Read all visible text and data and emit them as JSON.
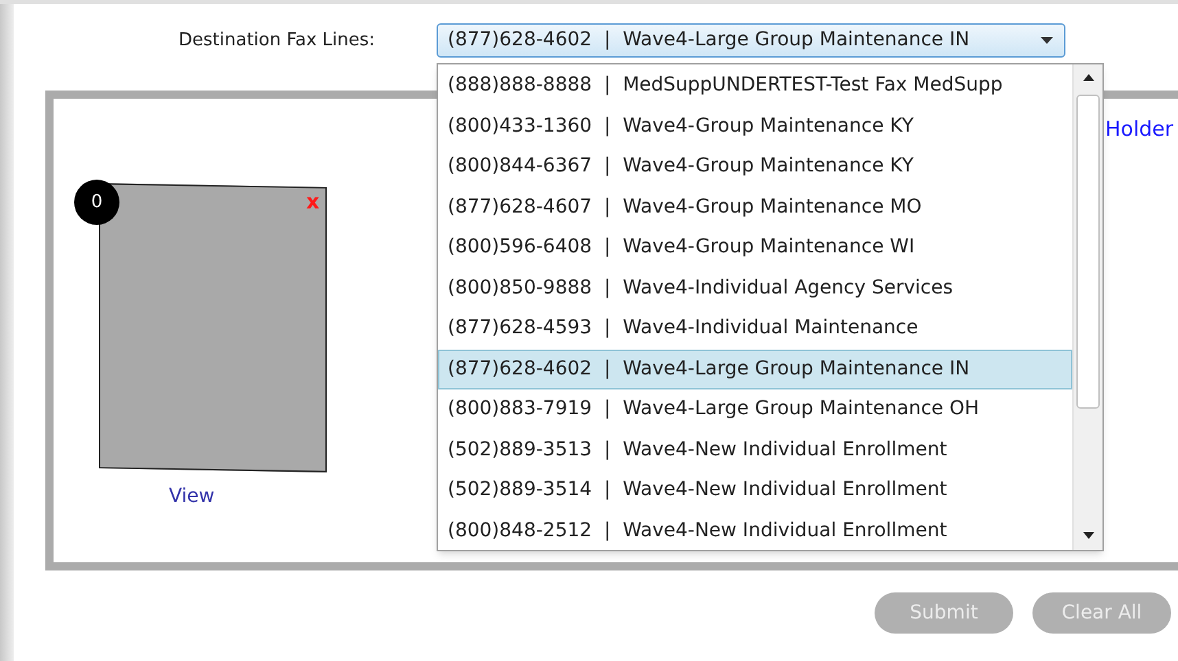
{
  "fax_lines": {
    "label": "Destination Fax Lines:",
    "value": "(877)628-4602  |  Wave4-Large Group Maintenance IN",
    "expanded": true,
    "options": [
      {
        "text": "(888)888-8888  |  MedSuppUNDERTEST-Test Fax MedSupp",
        "selected": false
      },
      {
        "text": "(800)433-1360  |  Wave4-Group Maintenance KY",
        "selected": false
      },
      {
        "text": "(800)844-6367  |  Wave4-Group Maintenance KY",
        "selected": false
      },
      {
        "text": "(877)628-4607  |  Wave4-Group Maintenance MO",
        "selected": false
      },
      {
        "text": "(800)596-6408  |  Wave4-Group Maintenance WI",
        "selected": false
      },
      {
        "text": "(800)850-9888  |  Wave4-Individual Agency Services",
        "selected": false
      },
      {
        "text": "(877)628-4593  |  Wave4-Individual Maintenance",
        "selected": false
      },
      {
        "text": "(877)628-4602  |  Wave4-Large Group Maintenance IN",
        "selected": true
      },
      {
        "text": "(800)883-7919  |  Wave4-Large Group Maintenance OH",
        "selected": false
      },
      {
        "text": "(502)889-3513  |  Wave4-New Individual Enrollment",
        "selected": false
      },
      {
        "text": "(502)889-3514  |  Wave4-New Individual Enrollment",
        "selected": false
      },
      {
        "text": "(800)848-2512  |  Wave4-New Individual Enrollment",
        "selected": false
      }
    ]
  },
  "panel": {
    "link": "Holder",
    "page": {
      "count": "0",
      "remove": "x",
      "view": "View"
    }
  },
  "buttons": [
    {
      "label": "Submit",
      "disabled": true
    },
    {
      "label": "Clear All",
      "disabled": true
    }
  ]
}
